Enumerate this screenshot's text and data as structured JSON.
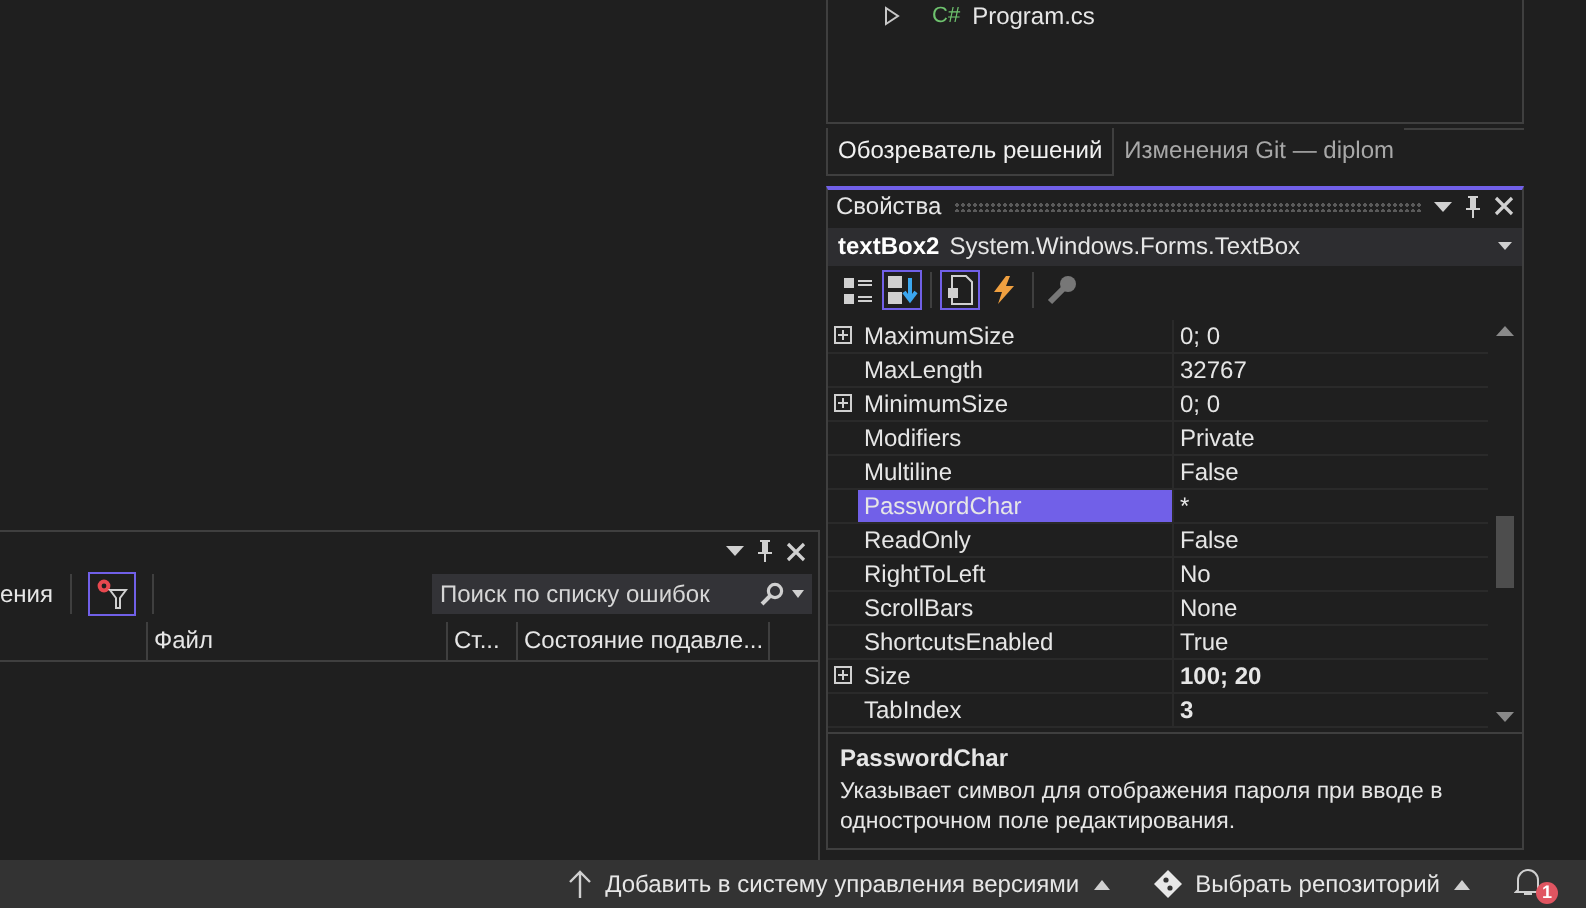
{
  "solution_explorer": {
    "items": [
      {
        "icon": "C#",
        "label": "Program.cs",
        "expanded": false
      }
    ],
    "tabs": [
      {
        "label": "Обозреватель решений",
        "selected": true
      },
      {
        "label": "Изменения Git — diplom",
        "selected": false
      }
    ]
  },
  "error_list": {
    "toolbar_text": "ения",
    "filter_active": true,
    "search": {
      "placeholder": "Поиск по списку ошибок"
    },
    "columns": [
      "Файл",
      "Ст...",
      "Состояние подавле..."
    ]
  },
  "properties": {
    "title": "Свойства",
    "object_name": "textBox2",
    "object_type": "System.Windows.Forms.TextBox",
    "toolbar": [
      {
        "kind": "categorized",
        "selected": false
      },
      {
        "kind": "alphabetical",
        "selected": true
      },
      {
        "kind": "properties",
        "selected": true
      },
      {
        "kind": "events",
        "selected": false
      },
      {
        "kind": "pages",
        "selected": false
      }
    ],
    "rows": [
      {
        "name": "MaximumSize",
        "value": "0; 0",
        "expandable": true,
        "modified": false,
        "selected": false
      },
      {
        "name": "MaxLength",
        "value": "32767",
        "expandable": false,
        "modified": false,
        "selected": false
      },
      {
        "name": "MinimumSize",
        "value": "0; 0",
        "expandable": true,
        "modified": false,
        "selected": false
      },
      {
        "name": "Modifiers",
        "value": "Private",
        "expandable": false,
        "modified": false,
        "selected": false
      },
      {
        "name": "Multiline",
        "value": "False",
        "expandable": false,
        "modified": false,
        "selected": false
      },
      {
        "name": "PasswordChar",
        "value": "*",
        "expandable": false,
        "modified": false,
        "selected": true
      },
      {
        "name": "ReadOnly",
        "value": "False",
        "expandable": false,
        "modified": false,
        "selected": false
      },
      {
        "name": "RightToLeft",
        "value": "No",
        "expandable": false,
        "modified": false,
        "selected": false
      },
      {
        "name": "ScrollBars",
        "value": "None",
        "expandable": false,
        "modified": false,
        "selected": false
      },
      {
        "name": "ShortcutsEnabled",
        "value": "True",
        "expandable": false,
        "modified": false,
        "selected": false
      },
      {
        "name": "Size",
        "value": "100; 20",
        "expandable": true,
        "modified": true,
        "selected": false
      },
      {
        "name": "TabIndex",
        "value": "3",
        "expandable": false,
        "modified": true,
        "selected": false
      }
    ],
    "description": {
      "title": "PasswordChar",
      "text": "Указывает символ для отображения пароля при вводе в однострочном поле редактирования."
    }
  },
  "status_bar": {
    "items": [
      {
        "kind": "add-to-source-control",
        "label": "Добавить в систему управления версиями"
      },
      {
        "kind": "select-repository",
        "label": "Выбрать репозиторий"
      }
    ],
    "notifications": "1"
  }
}
